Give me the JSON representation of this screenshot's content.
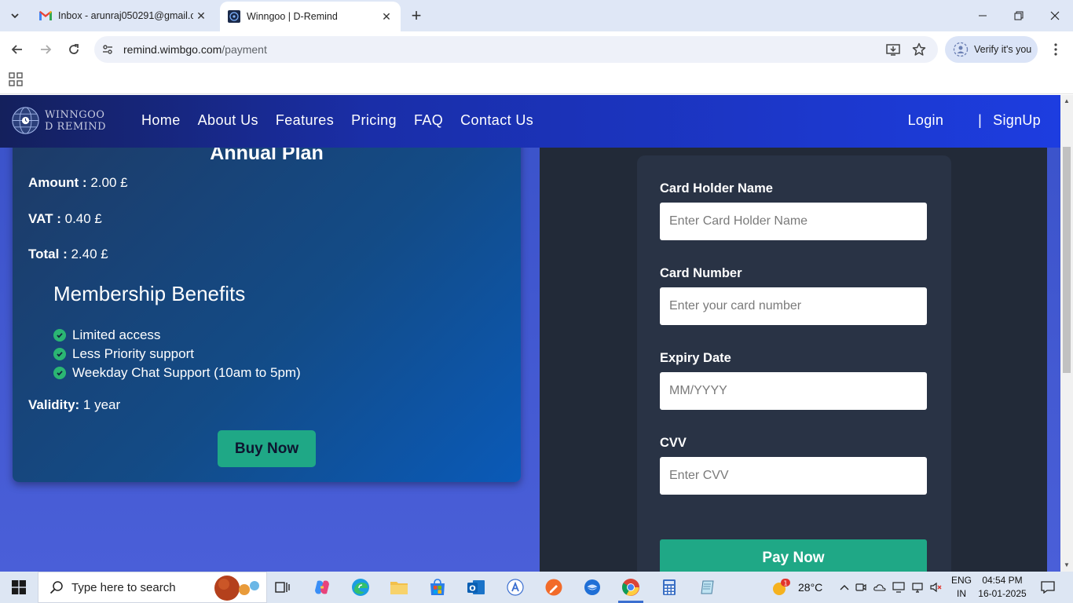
{
  "browser": {
    "tabs": [
      {
        "title": "Inbox - arunraj050291@gmail.c",
        "favicon": "gmail-icon",
        "active": false
      },
      {
        "title": "Winngoo | D-Remind",
        "favicon": "winngoo-icon",
        "active": true
      }
    ],
    "url_host": "remind.wimbgo.com",
    "url_path": "/payment",
    "verify_label": "Verify it's you"
  },
  "site": {
    "logo_line1": "WINNGOO",
    "logo_line2": "D REMIND",
    "nav": [
      "Home",
      "About Us",
      "Features",
      "Pricing",
      "FAQ",
      "Contact Us"
    ],
    "login": "Login",
    "separator": "|",
    "signup": "SignUp"
  },
  "plan": {
    "title": "Annual Plan",
    "amount_label": "Amount :",
    "amount_value": "2.00 £",
    "vat_label": "VAT :",
    "vat_value": "0.40 £",
    "total_label": "Total :",
    "total_value": "2.40 £",
    "benefits_title": "Membership Benefits",
    "benefits": [
      "Limited access",
      "Less Priority support",
      "Weekday Chat Support (10am to 5pm)"
    ],
    "validity_label": "Validity:",
    "validity_value": "1 year",
    "buy_label": "Buy Now"
  },
  "payment": {
    "card_holder_label": "Card Holder Name",
    "card_holder_placeholder": "Enter Card Holder Name",
    "card_number_label": "Card Number",
    "card_number_placeholder": "Enter your card number",
    "expiry_label": "Expiry Date",
    "expiry_placeholder": "MM/YYYY",
    "cvv_label": "CVV",
    "cvv_placeholder": "Enter CVV",
    "pay_label": "Pay Now"
  },
  "taskbar": {
    "search_placeholder": "Type here to search",
    "weather": "28°C",
    "lang_line1": "ENG",
    "lang_line2": "IN",
    "time": "04:54 PM",
    "date": "16-01-2025",
    "weather_badge": "1"
  },
  "colors": {
    "accent_green": "#1fa886",
    "nav_blue": "#1d3de0",
    "panel_dark": "#222a38"
  }
}
